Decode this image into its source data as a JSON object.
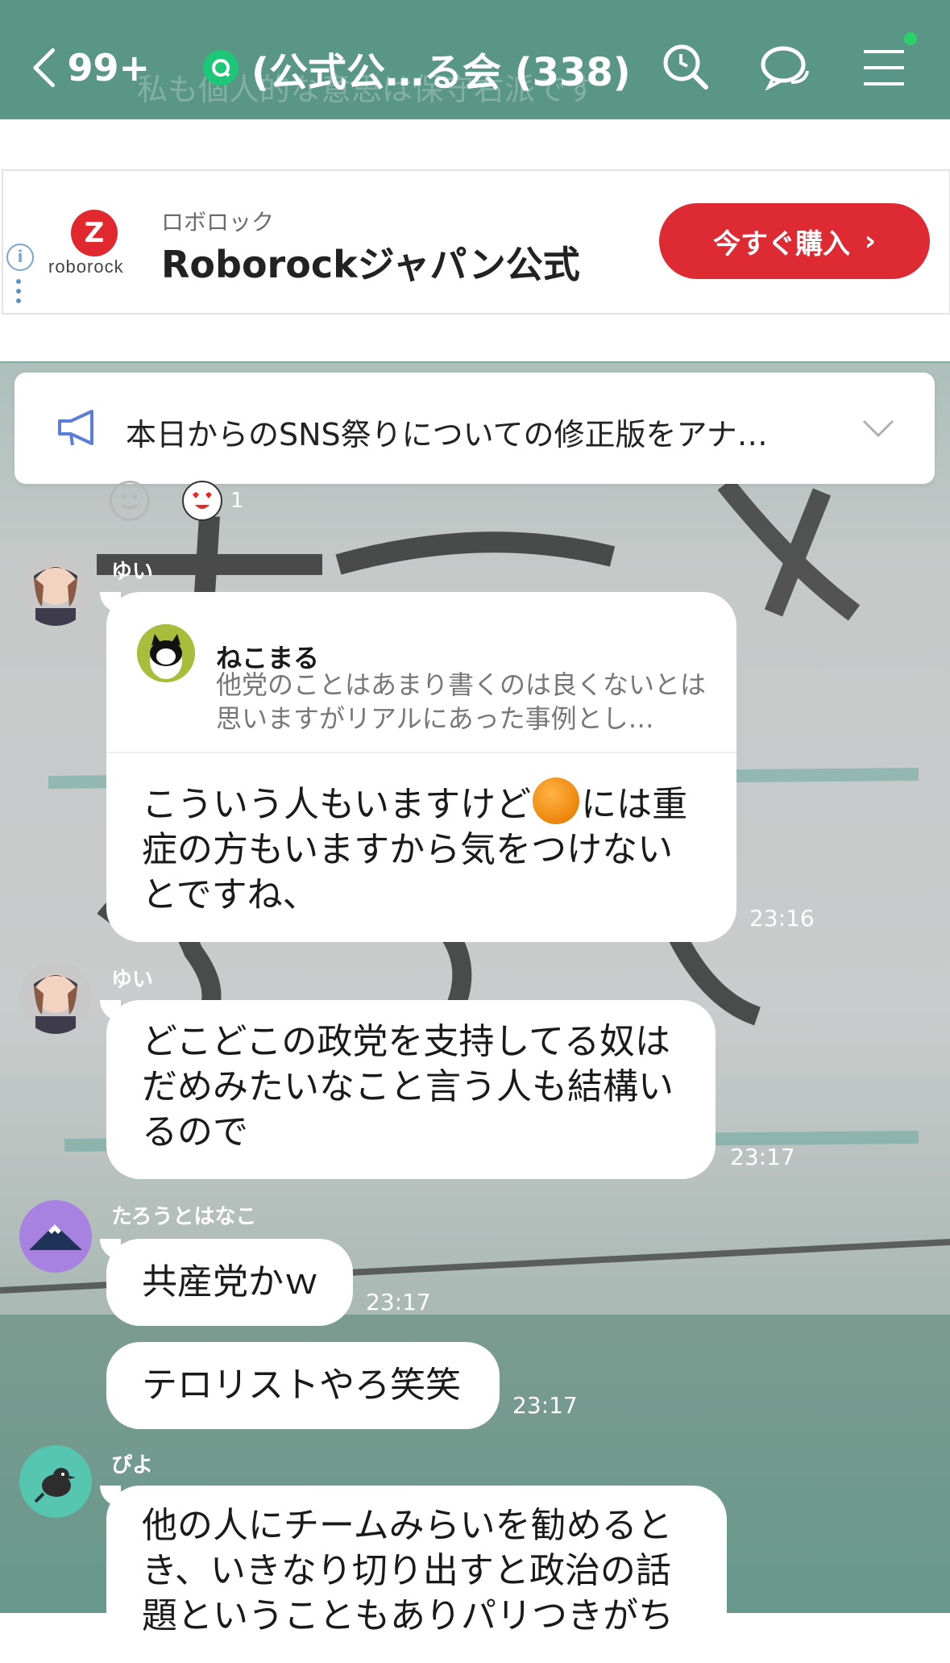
{
  "header": {
    "back_count": "99+",
    "title": "(公式公…る会 (338)",
    "faint_text": "私も個人的な意思は保守右派です"
  },
  "ad": {
    "brand_logo_text": "roborock",
    "subtitle": "ロボロック",
    "title": "Roborockジャパン公式",
    "cta_label": "今すぐ購入",
    "info_icon": "i"
  },
  "notice": {
    "text": "本日からのSNS祭りについての修正版をアナ…"
  },
  "reaction": {
    "count": "1"
  },
  "messages": [
    {
      "sender": "ゆい",
      "quote_name": "ねこまる",
      "quote_text": "他党のことはあまり書くのは良くないとは思いますがリアルにあった事例とし…",
      "text_line1_a": "こういう人もいますけど",
      "text_line1_b": "には重",
      "text_line2": "症の方もいますから気をつけない",
      "text_line3": "とですね、",
      "time": "23:16"
    },
    {
      "sender": "ゆい",
      "text_lines": [
        "どこどこの政党を支持してる奴は",
        "だめみたいなこと言う人も結構い",
        "るので"
      ],
      "time": "23:17"
    },
    {
      "sender": "たろうとはなこ",
      "text": "共産党かｗ",
      "time": "23:17"
    },
    {
      "text": "テロリストやろ笑笑",
      "time": "23:17"
    },
    {
      "sender": "ぴよ",
      "text_lines": [
        "他の人にチームみらいを勧めると",
        "き、いきなり切り出すと政治の話",
        "題ということもありパリつきがち"
      ]
    }
  ],
  "colors": {
    "header_bg": "#5b9684",
    "ad_button": "#dd2a33",
    "line_green": "#1dc778",
    "notice_icon": "#5b7fd9"
  },
  "icons": [
    "chevron-left-icon",
    "openchat-icon",
    "search-icon",
    "chat-bubbles-icon",
    "menu-icon",
    "info-icon",
    "megaphone-icon",
    "chevron-down-icon",
    "smile-icon"
  ]
}
